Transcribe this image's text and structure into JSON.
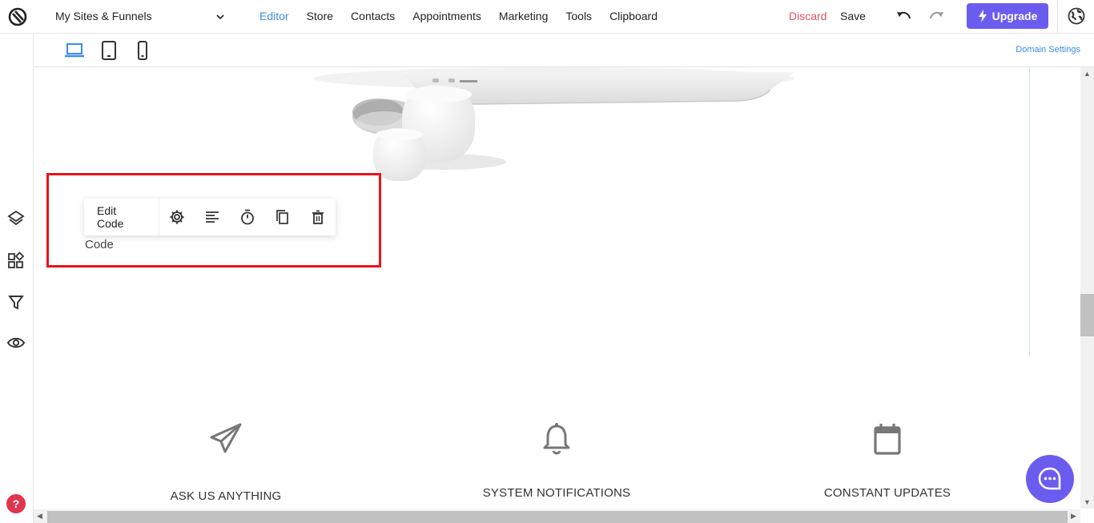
{
  "topbar": {
    "site_selector": "My Sites & Funnels",
    "nav": [
      "Editor",
      "Store",
      "Contacts",
      "Appointments",
      "Marketing",
      "Tools",
      "Clipboard"
    ],
    "active_nav": "Editor",
    "discard_label": "Discard",
    "save_label": "Save",
    "upgrade_label": "Upgrade"
  },
  "devicebar": {
    "devices": [
      "desktop-icon",
      "tablet-icon",
      "mobile-icon"
    ],
    "active_device": "desktop",
    "domain_settings": "Domain Settings"
  },
  "leftbar": {
    "icons": [
      "layers-icon",
      "widgets-icon",
      "filter-icon",
      "eye-icon"
    ]
  },
  "element_toolbar": {
    "edit_label": "Edit Code",
    "icons": [
      "gear-icon",
      "align-icon",
      "timer-icon",
      "duplicate-icon",
      "trash-icon"
    ]
  },
  "element": {
    "label": "Code"
  },
  "features": [
    {
      "icon": "paper-plane-icon",
      "label": "ASK US ANYTHING"
    },
    {
      "icon": "bell-icon",
      "label": "SYSTEM NOTIFICATIONS"
    },
    {
      "icon": "calendar-icon",
      "label": "CONSTANT UPDATES"
    }
  ],
  "colors": {
    "accent": "#3b8beb",
    "discard": "#e1535f",
    "upgrade": "#6b5cf0",
    "selection": "#e8141b",
    "help": "#e0344f"
  }
}
